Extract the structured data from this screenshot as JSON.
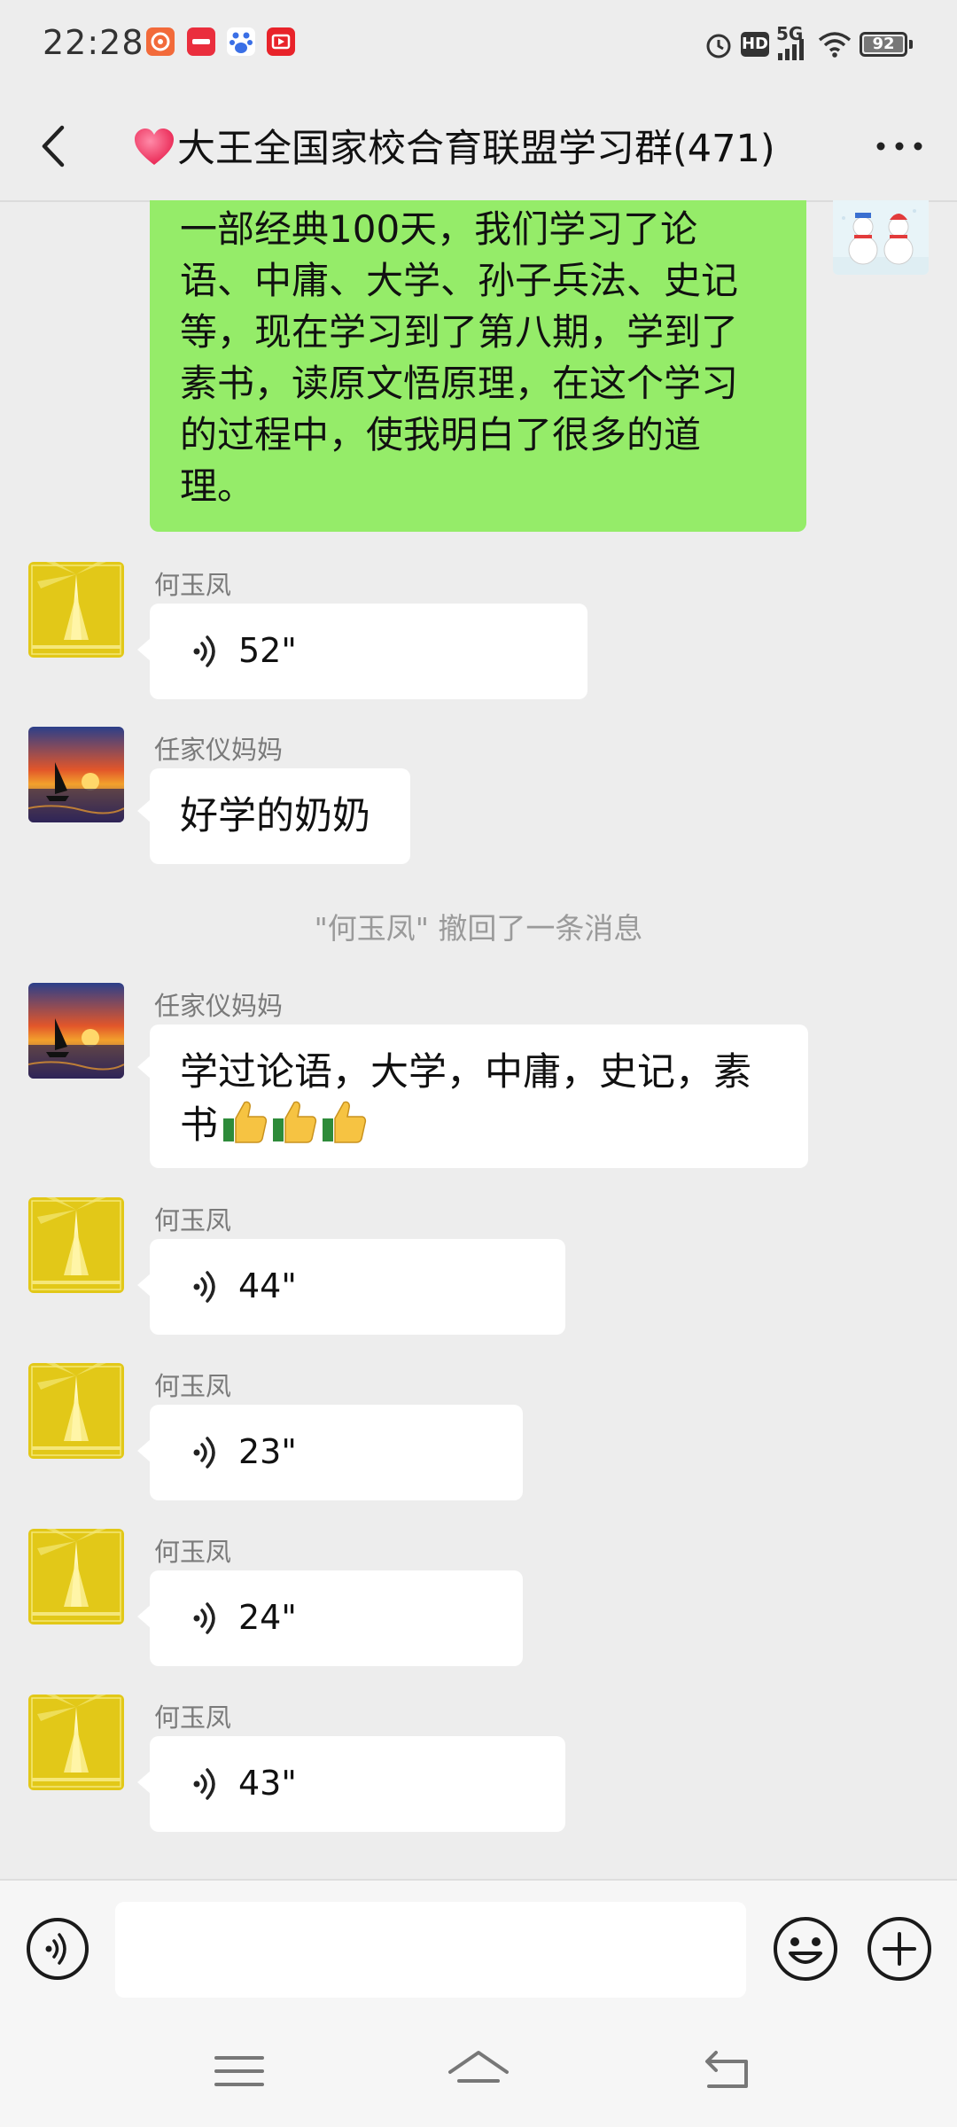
{
  "status_bar": {
    "time": "22:28",
    "network": "5G",
    "hd": "HD",
    "battery": "92",
    "app_icons": [
      {
        "name": "wps-icon",
        "color": "#f26a3a",
        "text": "WPS"
      },
      {
        "name": "xiaohongshu-icon",
        "color": "#ea2e3d",
        "text": "小红书"
      },
      {
        "name": "baidu-icon",
        "color": "#3a6fe6",
        "text": "百度"
      },
      {
        "name": "video-app-icon",
        "color": "#e8232a",
        "text": "▶"
      }
    ]
  },
  "header": {
    "back_icon": "chevron-left-icon",
    "title": "大王全国家校合育联盟学习群(471)",
    "more_icon": "more-dots-icon"
  },
  "messages": {
    "my_message": {
      "lines": [
        "一部经典100天，我们学习了论",
        "语、中庸、大学、孙子兵法、史记",
        "等，现在学习到了第八期，学到了",
        "素书，读原文悟原理，在这个学习",
        "的过程中，使我明白了很多的道",
        "理。"
      ],
      "bubble_color": "#95ec69"
    },
    "items": [
      {
        "sender": "何玉凤",
        "type": "voice",
        "duration": "52\""
      },
      {
        "sender": "任家仪妈妈",
        "type": "text",
        "text": "好学的奶奶"
      },
      {
        "type": "system",
        "text": "\"何玉凤\" 撤回了一条消息"
      },
      {
        "sender": "任家仪妈妈",
        "type": "text",
        "line1": "学过论语，大学，中庸，史记，素",
        "line2": "书"
      },
      {
        "sender": "何玉凤",
        "type": "voice",
        "duration": "44\""
      },
      {
        "sender": "何玉凤",
        "type": "voice",
        "duration": "23\""
      },
      {
        "sender": "何玉凤",
        "type": "voice",
        "duration": "24\""
      },
      {
        "sender": "何玉凤",
        "type": "voice",
        "duration": "43\""
      }
    ]
  },
  "input_bar": {
    "voice_icon": "voice-input-icon",
    "placeholder": "",
    "emoji_icon": "emoji-icon",
    "plus_icon": "plus-icon"
  },
  "nav_bar": {
    "icons": [
      "menu-icon",
      "home-icon",
      "back-icon"
    ]
  }
}
